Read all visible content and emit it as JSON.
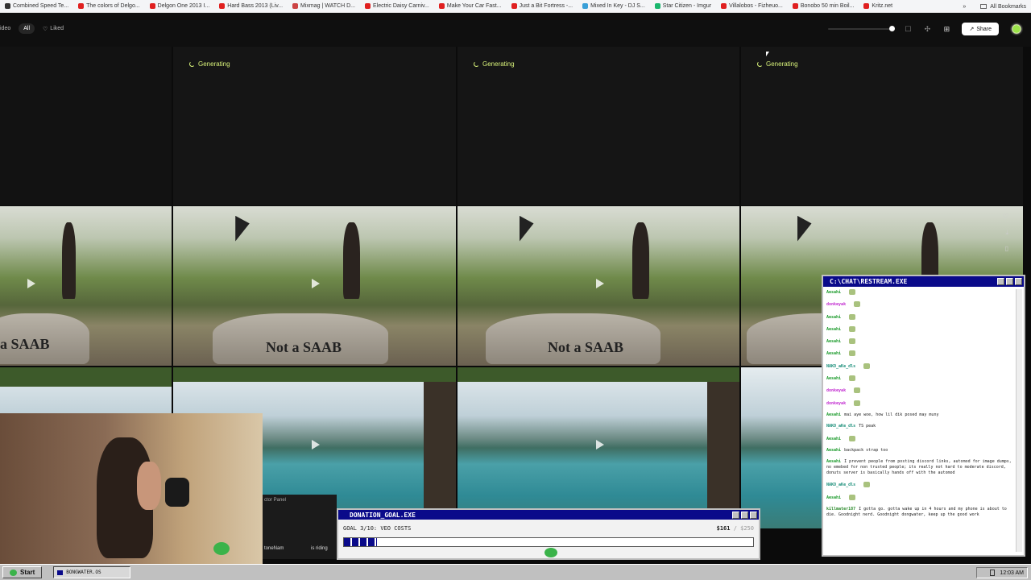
{
  "bookmarks": {
    "items": [
      {
        "label": "Combined Speed Te...",
        "color": "#333333"
      },
      {
        "label": "The colors of Delgo...",
        "color": "#e02020"
      },
      {
        "label": "Delgon One 2013 I...",
        "color": "#e02020"
      },
      {
        "label": "Hard Bass 2013 (Liv...",
        "color": "#e02020"
      },
      {
        "label": "Mixmag | WATCH D...",
        "color": "#c44"
      },
      {
        "label": "Electric Daisy Carniv...",
        "color": "#e02020"
      },
      {
        "label": "Make Your Car Fast...",
        "color": "#e02020"
      },
      {
        "label": "Just a Bit Fortress -...",
        "color": "#e02020"
      },
      {
        "label": "Mixed In Key - DJ S...",
        "color": "#3aa0d8"
      },
      {
        "label": "Star Citizen - Imgur",
        "color": "#1bb76e"
      },
      {
        "label": "Villalobos - Fizheuo...",
        "color": "#e02020"
      },
      {
        "label": "Bonobo 50 min Boil...",
        "color": "#e02020"
      },
      {
        "label": "Kritz.net",
        "color": "#e02020"
      }
    ],
    "overflow": "»",
    "all_label": "All Bookmarks"
  },
  "toolbar": {
    "filter_video": "ideo",
    "filter_all": "All",
    "filter_liked": "Liked",
    "share_label": "Share"
  },
  "grid": {
    "generating_label": "Generating",
    "saab_text": "Not a SAAB",
    "saab_text_partial": "a SAAB"
  },
  "chat": {
    "title": "C:\\CHAT\\RESTREAM.EXE",
    "messages": [
      {
        "user": "Aesahi",
        "text": "",
        "cls": "u1"
      },
      {
        "user": "donkeyak",
        "text": "",
        "cls": "u2"
      },
      {
        "user": "Aesahi",
        "text": "",
        "cls": "u1"
      },
      {
        "user": "Aesahi",
        "text": "",
        "cls": "u1"
      },
      {
        "user": "Aesahi",
        "text": "",
        "cls": "u1"
      },
      {
        "user": "Aesahi",
        "text": "",
        "cls": "u1"
      },
      {
        "user": "NAKO_aKe_dls",
        "text": "",
        "cls": "u3"
      },
      {
        "user": "Aesahi",
        "text": "",
        "cls": "u1"
      },
      {
        "user": "donkeyak",
        "text": "",
        "cls": "u2"
      },
      {
        "user": "donkeyak",
        "text": "",
        "cls": "u2"
      },
      {
        "user": "Aesahi",
        "text": "mai aye woe, how lil dik posed may muny",
        "cls": "u1"
      },
      {
        "user": "NAKO_aKe_dls",
        "text": "TS peak",
        "cls": "u3"
      },
      {
        "user": "Aesahi",
        "text": "",
        "cls": "u1"
      },
      {
        "user": "Aesahi",
        "text": "backpack strap too",
        "cls": "u1"
      },
      {
        "user": "Aesahi",
        "text": "I prevent people from posting discord links, automod for image dumps, no emebed for non trusted people; its really not hard to moderate discord, donuts server is basically hands off with the automod",
        "cls": "u1"
      },
      {
        "user": "NAKO_aKe_dls",
        "text": "",
        "cls": "u3"
      },
      {
        "user": "Aesahi",
        "text": "",
        "cls": "u1"
      },
      {
        "user": "killmater187",
        "text": "I gotta go. gotta wake up in 4 hours and my phone is about to die. Goodnight nerd. Goodnight dongwater, keep up the good work",
        "cls": "u4"
      }
    ]
  },
  "donation": {
    "title": "DONATION_GOAL.EXE",
    "goal_label": "GOAL 3/10: VEO COSTS",
    "raised": "$161",
    "target": "/ $250",
    "progress": 0.644
  },
  "panel": {
    "title": "ctor Panel",
    "name_label": "toneNam",
    "riding_text": "is riding"
  },
  "taskbar": {
    "start_label": "Start",
    "task_label": "BONGWATER.OS",
    "clock": "12:03 AM"
  }
}
